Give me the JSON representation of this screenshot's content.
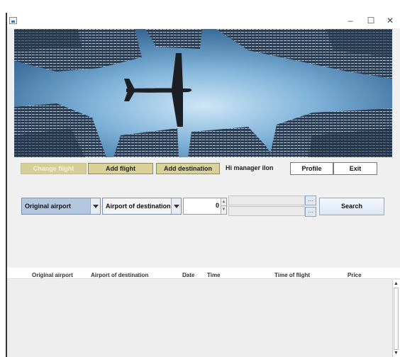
{
  "window": {
    "controls": {
      "minimize": "–",
      "maximize": "☐",
      "close": "✕"
    },
    "icon": "java-app-icon"
  },
  "banner": {
    "image": "airplane-between-skyscrapers",
    "colors": {
      "sky": "#5b95c4",
      "plane": "#1c1f24"
    }
  },
  "toolbar": {
    "change_flight": "Change flight",
    "add_flight": "Add flight",
    "add_destination": "Add destination",
    "greeting": "Hi manager ilon",
    "profile": "Profile",
    "exit": "Exit",
    "button_color": "#d8d298"
  },
  "search": {
    "origin": "Original airport",
    "destination": "Airport of destination",
    "count": "0",
    "date_button": "...",
    "search_button": "Search"
  },
  "table": {
    "columns": [
      "Original airport",
      "Airport of destination",
      "Date",
      "Time",
      "Time of flight",
      "Price"
    ],
    "rows": []
  }
}
